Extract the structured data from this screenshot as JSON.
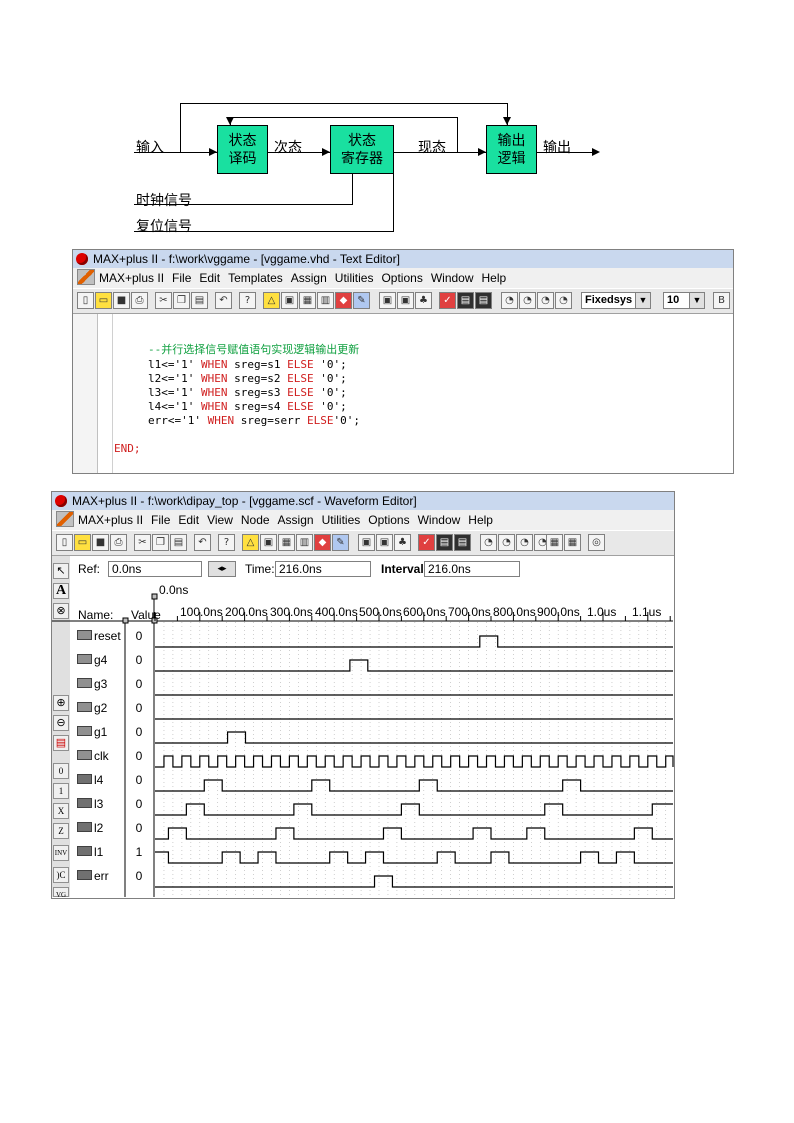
{
  "diagram": {
    "input_label": "输入",
    "block1": [
      "状态",
      "译码"
    ],
    "next_state_label": "次态",
    "block2": [
      "状态",
      "寄存器"
    ],
    "present_state_label": "现态",
    "block3": [
      "输出",
      "逻辑"
    ],
    "output_label": "输出",
    "clock_label": "时钟信号",
    "reset_label": "复位信号",
    "block_color": "#19e0a0"
  },
  "text_editor": {
    "title": "MAX+plus II - f:\\work\\vggame - [vggame.vhd - Text Editor]",
    "menu": [
      "MAX+plus II",
      "File",
      "Edit",
      "Templates",
      "Assign",
      "Utilities",
      "Options",
      "Window",
      "Help"
    ],
    "font_combo": "Fixedsys",
    "size_combo": "10",
    "comment": "--并行选择信号赋值语句实现逻辑输出更新",
    "lines": [
      {
        "a": "l1<='1' ",
        "w": "WHEN",
        "b": " sreg=s1 ",
        "e": "ELSE",
        "c": " '0';"
      },
      {
        "a": "l2<='1' ",
        "w": "WHEN",
        "b": " sreg=s2 ",
        "e": "ELSE",
        "c": " '0';"
      },
      {
        "a": "l3<='1' ",
        "w": "WHEN",
        "b": " sreg=s3 ",
        "e": "ELSE",
        "c": " '0';"
      },
      {
        "a": "l4<='1' ",
        "w": "WHEN",
        "b": " sreg=s4 ",
        "e": "ELSE",
        "c": " '0';"
      },
      {
        "a": "err<='1' ",
        "w": "WHEN",
        "b": " sreg=serr ",
        "e": "ELSE",
        "c": "'0';"
      }
    ],
    "end_line": "END;",
    "keyword_color": "#d02020",
    "comment_color": "#10a040"
  },
  "waveform_editor": {
    "title": "MAX+plus II - f:\\work\\dipay_top - [vggame.scf - Waveform Editor]",
    "menu": [
      "MAX+plus II",
      "File",
      "Edit",
      "View",
      "Node",
      "Assign",
      "Utilities",
      "Options",
      "Window",
      "Help"
    ],
    "ref_label": "Ref:",
    "ref_value": "0.0ns",
    "time_label": "Time:",
    "time_value": "216.0ns",
    "interval_label": "Interval:",
    "interval_value": "216.0ns",
    "cursor_label": "0.0ns",
    "name_header": "Name:",
    "value_header": "Value",
    "ticks": [
      "100.0ns",
      "200.0ns",
      "300.0ns",
      "400.0ns",
      "500.0ns",
      "600.0ns",
      "700.0ns",
      "800.0ns",
      "900.0ns",
      "1.0us",
      "1.1us"
    ],
    "signals": [
      {
        "name": "reset",
        "value": "0",
        "dir": "in",
        "wave": [
          [
            0,
            0
          ],
          [
            725,
            1
          ],
          [
            765,
            0
          ]
        ]
      },
      {
        "name": "g4",
        "value": "0",
        "dir": "in",
        "wave": [
          [
            0,
            0
          ],
          [
            435,
            1
          ],
          [
            475,
            0
          ]
        ]
      },
      {
        "name": "g3",
        "value": "0",
        "dir": "in",
        "wave": [
          [
            0,
            0
          ]
        ]
      },
      {
        "name": "g2",
        "value": "0",
        "dir": "in",
        "wave": [
          [
            0,
            0
          ]
        ]
      },
      {
        "name": "g1",
        "value": "0",
        "dir": "in",
        "wave": [
          [
            0,
            0
          ],
          [
            162,
            1
          ],
          [
            202,
            0
          ]
        ]
      },
      {
        "name": "clk",
        "value": "0",
        "dir": "in",
        "wave": "clock"
      },
      {
        "name": "l4",
        "value": "0",
        "dir": "out",
        "wave": [
          [
            0,
            0
          ],
          [
            110,
            1
          ],
          [
            150,
            0
          ],
          [
            350,
            1
          ],
          [
            390,
            0
          ],
          [
            590,
            1
          ],
          [
            630,
            0
          ],
          [
            910,
            1
          ],
          [
            950,
            0
          ]
        ]
      },
      {
        "name": "l3",
        "value": "0",
        "dir": "out",
        "wave": [
          [
            0,
            0
          ],
          [
            70,
            1
          ],
          [
            110,
            0
          ],
          [
            310,
            1
          ],
          [
            350,
            0
          ],
          [
            550,
            1
          ],
          [
            590,
            0
          ],
          [
            870,
            1
          ],
          [
            910,
            0
          ],
          [
            1110,
            1
          ]
        ]
      },
      {
        "name": "l2",
        "value": "0",
        "dir": "out",
        "wave": [
          [
            0,
            0
          ],
          [
            30,
            1
          ],
          [
            70,
            0
          ],
          [
            270,
            1
          ],
          [
            310,
            0
          ],
          [
            510,
            1
          ],
          [
            550,
            0
          ],
          [
            710,
            1
          ],
          [
            750,
            0
          ],
          [
            830,
            1
          ],
          [
            870,
            0
          ],
          [
            1070,
            1
          ],
          [
            1110,
            0
          ]
        ]
      },
      {
        "name": "l1",
        "value": "1",
        "dir": "out",
        "wave": [
          [
            0,
            1
          ],
          [
            30,
            0
          ],
          [
            150,
            1
          ],
          [
            190,
            0
          ],
          [
            230,
            1
          ],
          [
            270,
            0
          ],
          [
            390,
            1
          ],
          [
            430,
            0
          ],
          [
            470,
            1
          ],
          [
            510,
            0
          ],
          [
            630,
            1
          ],
          [
            670,
            0
          ],
          [
            750,
            1
          ],
          [
            790,
            0
          ],
          [
            950,
            1
          ],
          [
            990,
            0
          ],
          [
            1030,
            1
          ],
          [
            1070,
            0
          ]
        ]
      },
      {
        "name": "err",
        "value": "0",
        "dir": "out",
        "wave": [
          [
            0,
            0
          ],
          [
            490,
            1
          ],
          [
            530,
            0
          ]
        ]
      }
    ]
  }
}
